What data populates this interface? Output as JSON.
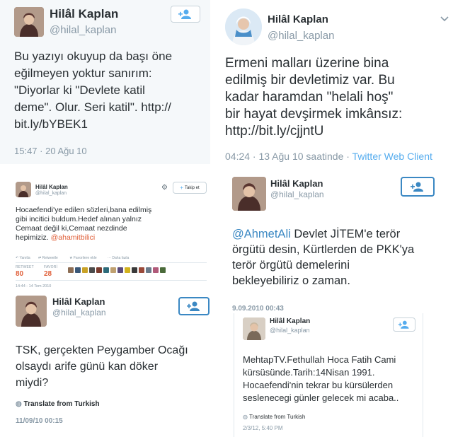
{
  "tweet1": {
    "name": "Hilâl Kaplan",
    "handle": "@hilal_kaplan",
    "text": "Bu yazıyı okuyup da başı öne\neğilmeyen yoktur sanırım:\n\"Diyorlar ki \"Devlete katil\ndeme\". Olur. Seri katil\". http://\nbit.ly/bYBEK1",
    "timestamp": "15:47 · 20 Ağu 10"
  },
  "tweet2": {
    "name": "Hilâl Kaplan",
    "handle": "@hilal_kaplan",
    "text": "Ermeni malları üzerine bina\nedilmiş bir devletimiz var. Bu\nkadar haramdan \"helali hoş\"\nbir hayat devşirmek imkânsız:\nhttp://bit.ly/cjjntU",
    "timestamp": "04:24 · 13 Ağu 10 saatinde · ",
    "client": "Twitter Web Client"
  },
  "tweet3": {
    "name": "Hilâl Kaplan",
    "handle": "@hilal_kaplan",
    "follow_label": "Takip et",
    "text_main": "Hocaefendi'ye edilen sözleri,bana edilmiş\ngibi incitici buldum.Hedef alınan yalnız\nCemaat değil ki,Cemaat nezdinde\nhepimiziz. ",
    "mention": "@ahamitbilici",
    "actions": [
      "Yanıtla",
      "Retweetle",
      "Favorilere ekle",
      "Daha fazla"
    ],
    "retweets_label": "RETWEET",
    "retweets_value": "80",
    "favorites_label": "FAVORİ",
    "favorites_value": "28",
    "timestamp": "14:44 - 14 Tem 2010"
  },
  "tweet4": {
    "name": "Hilâl Kaplan",
    "handle": "@hilal_kaplan",
    "mention": "@AhmetAli",
    "text_rest": " Devlet JİTEM'e terör\nörgütü desin, Kürtlerden de PKK'ya\nterör örgütü demelerini\nbekleyebiliriz o zaman.",
    "timestamp": "9.09.2010 00:43"
  },
  "tweet5": {
    "name": "Hilâl Kaplan",
    "handle": "@hilal_kaplan",
    "text": "TSK, gerçekten Peygamber Ocağı\nolsaydı arife günü kan döker\nmiydi?",
    "translate": "Translate from Turkish",
    "timestamp": "11/09/10 00:15"
  },
  "tweet6": {
    "name": "Hilâl Kaplan",
    "handle": "@hilal_kaplan",
    "text": "MehtapTV.Fethullah Hoca Fatih Cami\nkürsüsünde.Tarih:14Nisan 1991.\nHocaefendi'nin tekrar bu kürsülerden\nseslenecegi günler gelecek mi acaba..",
    "translate": "Translate from Turkish",
    "timestamp": "2/3/12, 5:40 PM"
  },
  "colors": {
    "accent": "#55acee",
    "follow_border": "#3b88c3",
    "stat": "#e0603a"
  },
  "icons": [
    "follow-user-plus-icon",
    "gear-icon",
    "chevron-down-icon",
    "globe-icon",
    "reply-icon",
    "retweet-icon",
    "favorite-icon",
    "more-icon"
  ]
}
